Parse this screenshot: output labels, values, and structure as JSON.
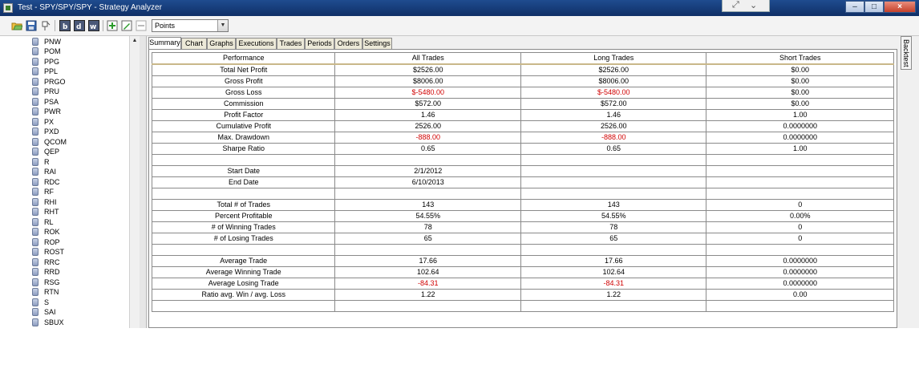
{
  "window": {
    "title": "Test - SPY/SPY/SPY - Strategy Analyzer"
  },
  "toolbar": {
    "buttons": [
      "open-icon",
      "save-icon",
      "pin-icon",
      "b-icon",
      "d-icon",
      "w-icon",
      "add-icon",
      "edit-icon",
      "remove-icon"
    ],
    "combo_value": "Points"
  },
  "symbols": [
    "PNW",
    "POM",
    "PPG",
    "PPL",
    "PRGO",
    "PRU",
    "PSA",
    "PWR",
    "PX",
    "PXD",
    "QCOM",
    "QEP",
    "R",
    "RAI",
    "RDC",
    "RF",
    "RHI",
    "RHT",
    "RL",
    "ROK",
    "ROP",
    "ROST",
    "RRC",
    "RRD",
    "RSG",
    "RTN",
    "S",
    "SAI",
    "SBUX"
  ],
  "tabs": [
    "Summary",
    "Chart",
    "Graphs",
    "Executions",
    "Trades",
    "Periods",
    "Orders",
    "Settings"
  ],
  "side_tab": "Backtest",
  "colors": {
    "negative": "#d00000",
    "titlebar": "#1f4c8f"
  },
  "summary": {
    "headers": [
      "Performance",
      "All Trades",
      "Long Trades",
      "Short Trades"
    ],
    "rows": [
      [
        "Total Net Profit",
        "$2526.00",
        "$2526.00",
        "$0.00"
      ],
      [
        "Gross Profit",
        "$8006.00",
        "$8006.00",
        "$0.00"
      ],
      [
        "Gross Loss",
        "$-5480.00",
        "$-5480.00",
        "$0.00"
      ],
      [
        "Commission",
        "$572.00",
        "$572.00",
        "$0.00"
      ],
      [
        "Profit Factor",
        "1.46",
        "1.46",
        "1.00"
      ],
      [
        "Cumulative Profit",
        "2526.00",
        "2526.00",
        "0.0000000"
      ],
      [
        "Max. Drawdown",
        "-888.00",
        "-888.00",
        "0.0000000"
      ],
      [
        "Sharpe Ratio",
        "0.65",
        "0.65",
        "1.00"
      ],
      [
        "",
        "",
        "",
        ""
      ],
      [
        "Start Date",
        "2/1/2012",
        "",
        ""
      ],
      [
        "End Date",
        "6/10/2013",
        "",
        ""
      ],
      [
        "",
        "",
        "",
        ""
      ],
      [
        "Total # of Trades",
        "143",
        "143",
        "0"
      ],
      [
        "Percent Profitable",
        "54.55%",
        "54.55%",
        "0.00%"
      ],
      [
        "# of Winning Trades",
        "78",
        "78",
        "0"
      ],
      [
        "# of Losing Trades",
        "65",
        "65",
        "0"
      ],
      [
        "",
        "",
        "",
        ""
      ],
      [
        "Average Trade",
        "17.66",
        "17.66",
        "0.0000000"
      ],
      [
        "Average Winning Trade",
        "102.64",
        "102.64",
        "0.0000000"
      ],
      [
        "Average Losing Trade",
        "-84.31",
        "-84.31",
        "0.0000000"
      ],
      [
        "Ratio avg. Win / avg. Loss",
        "1.22",
        "1.22",
        "0.00"
      ],
      [
        "",
        "",
        "",
        ""
      ]
    ]
  }
}
